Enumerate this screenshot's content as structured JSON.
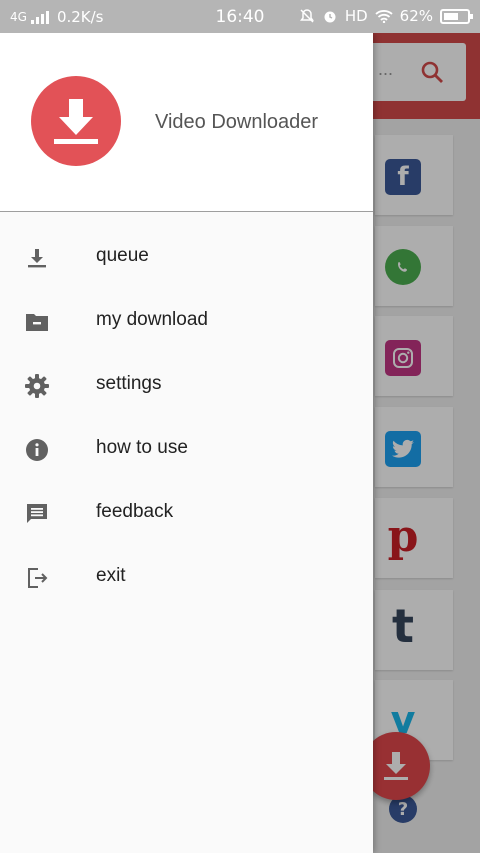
{
  "status_bar": {
    "network": "4G",
    "speed": "0.2K/s",
    "time": "16:40",
    "hd": "HD",
    "battery": "62%",
    "battery_level": 0.62
  },
  "drawer": {
    "app_name": "Video Downloader",
    "menu": [
      {
        "label": "queue",
        "icon": "download-icon"
      },
      {
        "label": "my download",
        "icon": "folder-icon"
      },
      {
        "label": "settings",
        "icon": "gear-icon"
      },
      {
        "label": "how to use",
        "icon": "info-icon"
      },
      {
        "label": "feedback",
        "icon": "feedback-icon"
      },
      {
        "label": "exit",
        "icon": "exit-icon"
      }
    ]
  },
  "background": {
    "search_placeholder": "...",
    "site_icons": [
      "facebook-icon",
      "whatsapp-icon",
      "instagram-icon",
      "twitter-icon",
      "pinterest-icon",
      "tumblr-icon",
      "vimeo-icon",
      "help-icon"
    ],
    "colors": {
      "accent": "#e0474c",
      "appbar": "#d34b4b"
    }
  }
}
